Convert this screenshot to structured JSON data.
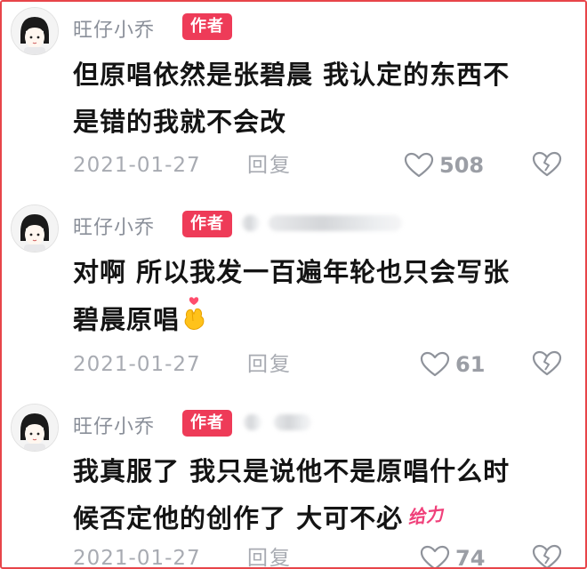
{
  "comments": [
    {
      "username": "旺仔小乔",
      "badge": "作者",
      "lines": [
        "但原唱依然是张碧晨 我认定的东西不",
        "是错的我就不会改"
      ],
      "date": "2021-01-27",
      "reply_label": "回复",
      "likes": "508"
    },
    {
      "username": "旺仔小乔",
      "badge": "作者",
      "lines": [
        "对啊 所以我发一百遍年轮也只会写张",
        "碧晨原唱"
      ],
      "date": "2021-01-27",
      "reply_label": "回复",
      "likes": "61",
      "emoji": "heart-hands-emoji"
    },
    {
      "username": "旺仔小乔",
      "badge": "作者",
      "lines": [
        "我真服了 我只是说他不是原唱什么时",
        "候否定他的创作了 大可不必"
      ],
      "sticker": "给力",
      "date": "2021-01-27",
      "reply_label": "回复",
      "likes": "74"
    }
  ],
  "colors": {
    "frame": "#e8454a",
    "badge": "#ee3b58",
    "username": "#8a8f99",
    "meta": "#a8abb2",
    "text": "#141414",
    "sticker": "#f0407a"
  },
  "icons": [
    "avatar",
    "heart-outline-icon",
    "broken-heart-icon"
  ]
}
